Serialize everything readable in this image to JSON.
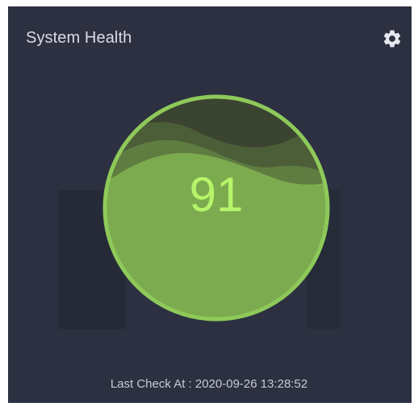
{
  "widget": {
    "title": "System Health",
    "score": "91",
    "score_fraction": 0.91,
    "last_check_label": "Last Check At : 2020-09-26 13:28:52",
    "settings_icon": "gear-icon",
    "colors": {
      "panel": "#2c3040",
      "gauge_fill": "#7cab4f",
      "gauge_ring": "#8ec95a",
      "score_text": "#b6f56a"
    }
  }
}
